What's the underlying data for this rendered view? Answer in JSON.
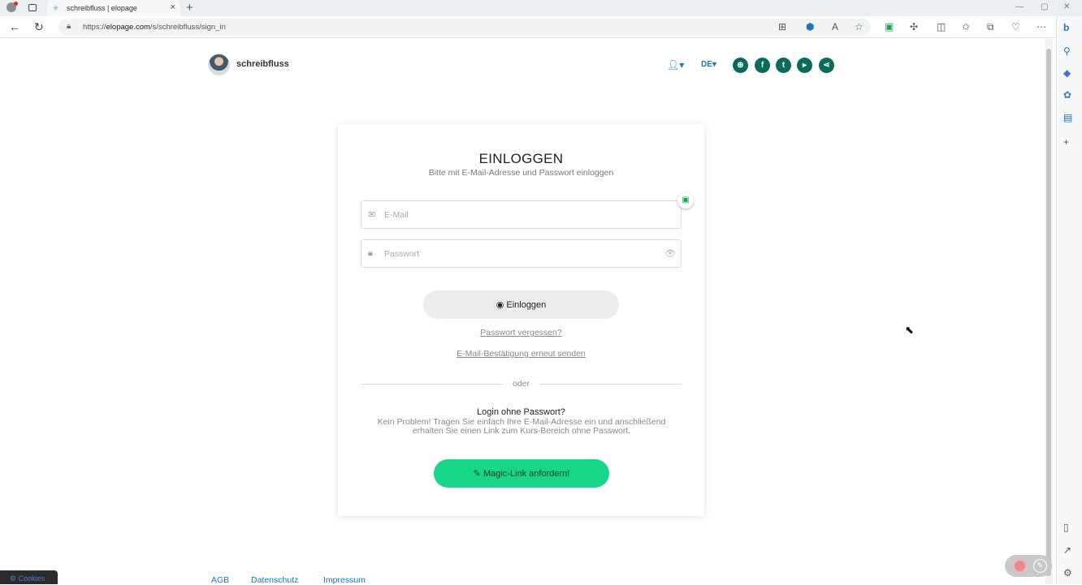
{
  "browser": {
    "tab_title": "schreibfluss | elopage",
    "url_prefix": "https://",
    "url_domain": "elopage.com",
    "url_path": "/s/schreibfluss/sign_in"
  },
  "header": {
    "brand": "schreibfluss",
    "language": "DE"
  },
  "login": {
    "title": "EINLOGGEN",
    "subtitle": "Bitte mit E-Mail-Adresse und Passwort einloggen",
    "email_placeholder": "E-Mail",
    "password_placeholder": "Passwort",
    "login_button": "Einloggen",
    "forgot_password": "Passwort vergessen?",
    "resend_confirmation": "E-Mail-Bestätigung erneut senden",
    "divider": "oder",
    "nopass_title": "Login ohne Passwort?",
    "nopass_text": "Kein Problem! Tragen Sie einfach Ihre E-Mail-Adresse ein und anschließend erhalten Sie einen Link zum Kurs-Bereich ohne Passwort.",
    "magic_button": "Magic-Link anfordern!"
  },
  "footer": {
    "links": [
      "AGB",
      "Datenschutz",
      "Impressum"
    ],
    "cookies": "Cookies"
  },
  "colors": {
    "accent_blue": "#1c75bc",
    "social_bg": "#0a6a5c",
    "magic_button": "#17d688"
  },
  "icons": {
    "social": [
      "globe-icon",
      "facebook-icon",
      "twitter-icon",
      "youtube-icon",
      "share-icon"
    ]
  }
}
